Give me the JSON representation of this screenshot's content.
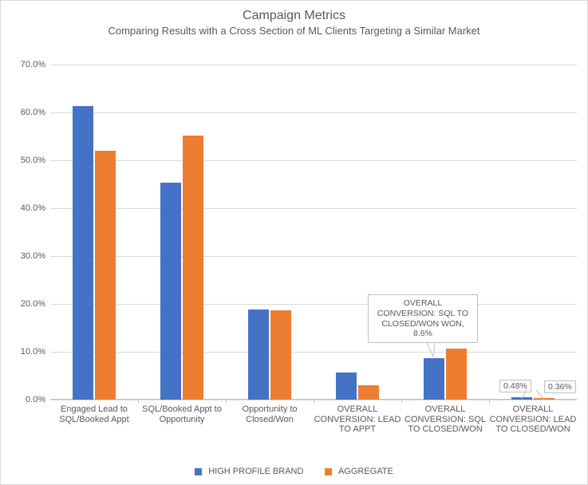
{
  "chart_data": {
    "type": "bar",
    "title": "Campaign Metrics",
    "subtitle": "Comparing  Results with a Cross Section of ML Clients Targeting a Similar Market",
    "ylabel": "",
    "xlabel": "",
    "ylim": [
      0,
      70
    ],
    "y_ticks": [
      0,
      10,
      20,
      30,
      40,
      50,
      60,
      70
    ],
    "y_tick_labels": [
      "0.0%",
      "10.0%",
      "20.0%",
      "30.0%",
      "40.0%",
      "50.0%",
      "60.0%",
      "70.0%"
    ],
    "categories": [
      "Engaged Lead to SQL/Booked Appt",
      "SQL/Booked Appt to Opportunity",
      "Opportunity to Closed/Won",
      "OVERALL CONVERSION: LEAD TO APPT",
      "OVERALL CONVERSION: SQL TO CLOSED/WON",
      "OVERALL CONVERSION: LEAD TO CLOSED/WON"
    ],
    "series": [
      {
        "name": "HIGH PROFILE BRAND",
        "color": "#4472c4",
        "values": [
          61.3,
          45.4,
          18.9,
          5.7,
          8.6,
          0.48
        ]
      },
      {
        "name": "AGGREGATE",
        "color": "#ed7d31",
        "values": [
          52.0,
          55.2,
          18.6,
          3.0,
          10.7,
          0.36
        ]
      }
    ],
    "callout": {
      "text": "OVERALL CONVERSION: SQL TO CLOSED/WON WON, 8.6%",
      "points_to": {
        "category_index": 4,
        "series_index": 0
      }
    },
    "data_labels": [
      {
        "category_index": 5,
        "series_index": 0,
        "text": "0.48%"
      },
      {
        "category_index": 5,
        "series_index": 1,
        "text": "0.36%"
      }
    ]
  }
}
